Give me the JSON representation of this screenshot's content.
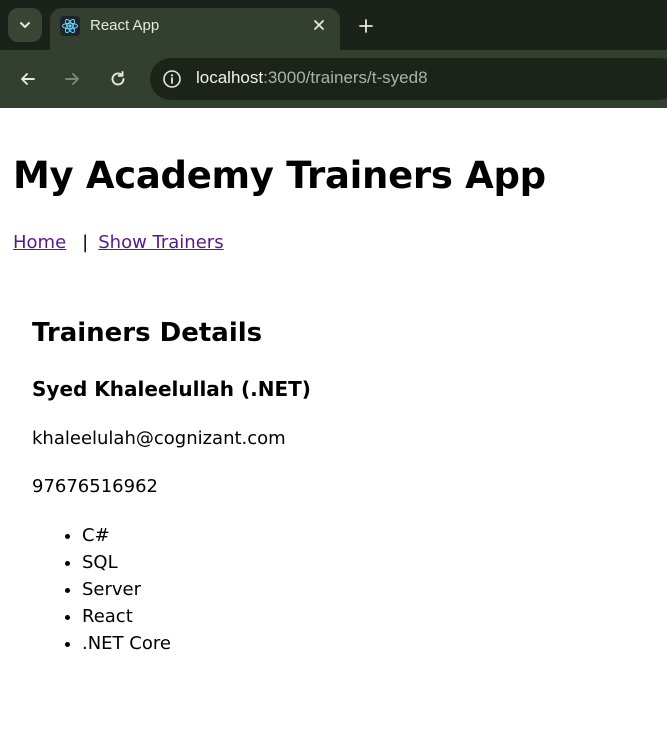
{
  "browser": {
    "tab_title": "React App",
    "url_host": "localhost",
    "url_path": ":3000/trainers/t-syed8"
  },
  "page": {
    "title": "My Academy Trainers App",
    "nav": {
      "home": "Home",
      "separator": "|",
      "show_trainers": "Show Trainers"
    },
    "details": {
      "heading": "Trainers Details",
      "trainer_name": "Syed Khaleelullah (.NET)",
      "email": "khaleelulah@cognizant.com",
      "phone": "97676516962",
      "skills": [
        "C#",
        "SQL",
        "Server",
        "React",
        ".NET Core"
      ]
    }
  },
  "icons": {
    "tab_menu": "chevron-down-icon",
    "favicon": "react-logo-icon",
    "tab_close": "close-icon",
    "new_tab": "plus-icon",
    "back": "arrow-left-icon",
    "forward": "arrow-right-icon",
    "reload": "reload-icon",
    "site_info": "info-icon"
  },
  "colors": {
    "chrome_bg": "#34402f",
    "tabstrip_bg": "#1a2219",
    "link_visited": "#551a8b"
  }
}
